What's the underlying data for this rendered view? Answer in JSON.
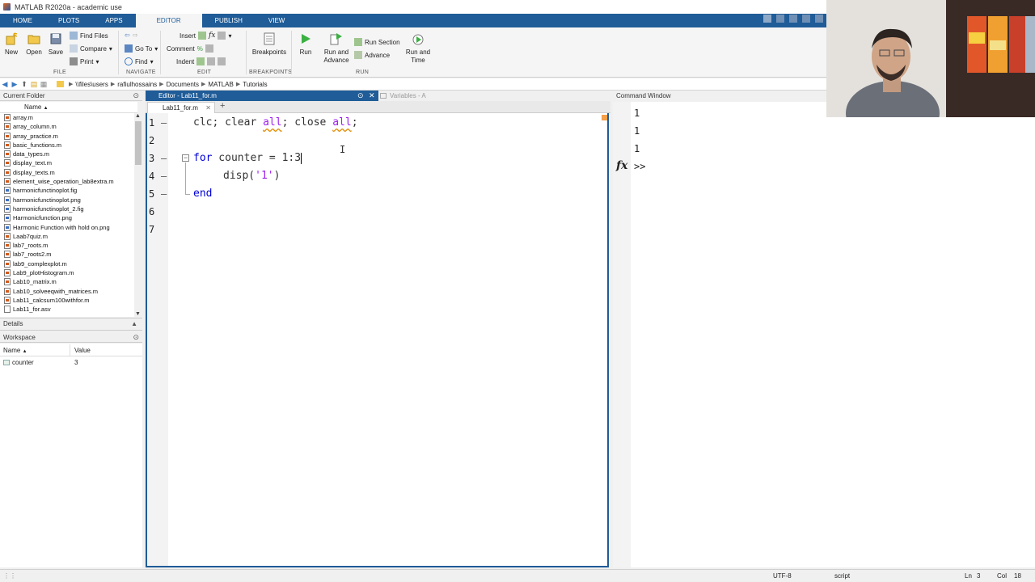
{
  "window": {
    "title": "MATLAB R2020a - academic use"
  },
  "main_tabs": [
    "HOME",
    "PLOTS",
    "APPS",
    "EDITOR",
    "PUBLISH",
    "VIEW"
  ],
  "active_tab": "EDITOR",
  "ribbon": {
    "file": {
      "new": "New",
      "open": "Open",
      "save": "Save",
      "find_files": "Find Files",
      "compare": "Compare",
      "print": "Print",
      "group": "FILE"
    },
    "navigate": {
      "go_to": "Go To",
      "find": "Find",
      "group": "NAVIGATE"
    },
    "edit": {
      "insert": "Insert",
      "comment": "Comment",
      "indent": "Indent",
      "fx": "fx",
      "group": "EDIT"
    },
    "breakpoints": {
      "label": "Breakpoints",
      "group": "BREAKPOINTS"
    },
    "run": {
      "run": "Run",
      "run_and_advance": "Run and Advance",
      "run_section": "Run Section",
      "advance": "Advance",
      "run_and_time": "Run and Time",
      "group": "RUN"
    }
  },
  "address": {
    "crumbs": [
      "\\\\files\\users",
      "rafiulhossains",
      "Documents",
      "MATLAB",
      "Tutorials"
    ]
  },
  "current_folder": {
    "title": "Current Folder",
    "column": "Name",
    "sort_indicator": "▲",
    "files": [
      {
        "name": "array.m",
        "type": "m"
      },
      {
        "name": "array_column.m",
        "type": "m"
      },
      {
        "name": "array_practice.m",
        "type": "m"
      },
      {
        "name": "basic_functions.m",
        "type": "m"
      },
      {
        "name": "data_types.m",
        "type": "m"
      },
      {
        "name": "display_text.m",
        "type": "m"
      },
      {
        "name": "display_texts.m",
        "type": "m"
      },
      {
        "name": "element_wise_operation_lab8extra.m",
        "type": "m"
      },
      {
        "name": "harmonicfunctinoplot.fig",
        "type": "f"
      },
      {
        "name": "harmonicfunctinoplot.png",
        "type": "f"
      },
      {
        "name": "harmonicfunctinoplot_2.fig",
        "type": "f"
      },
      {
        "name": "Harmonicfunction.png",
        "type": "f"
      },
      {
        "name": "Harmonic Function with hold on.png",
        "type": "f"
      },
      {
        "name": "Laab7quiz.m",
        "type": "m"
      },
      {
        "name": "lab7_roots.m",
        "type": "m"
      },
      {
        "name": "lab7_roots2.m",
        "type": "m"
      },
      {
        "name": "lab9_complexplot.m",
        "type": "m"
      },
      {
        "name": "Lab9_plotHistogram.m",
        "type": "m"
      },
      {
        "name": "Lab10_matrix.m",
        "type": "m"
      },
      {
        "name": "Lab10_solveeqwith_matrices.m",
        "type": "m"
      },
      {
        "name": "Lab11_calcsum100withfor.m",
        "type": "m"
      },
      {
        "name": "Lab11_for.asv",
        "type": "a"
      }
    ]
  },
  "details": {
    "title": "Details"
  },
  "workspace": {
    "title": "Workspace",
    "col_name": "Name",
    "col_value": "Value",
    "sort_indicator": "▲",
    "vars": [
      {
        "name": "counter",
        "value": "3"
      }
    ]
  },
  "editor": {
    "header": "Editor - Lab11_for.m",
    "variables_tab": "Variables - A",
    "file_tab": "Lab11_for.m",
    "add_tab": "+",
    "line_numbers": [
      "1",
      "2",
      "3",
      "4",
      "5",
      "6",
      "7"
    ],
    "code": {
      "l1_a": "clc; clear ",
      "l1_b": "all",
      "l1_c": "; close ",
      "l1_d": "all",
      "l1_e": ";",
      "l3_kw": "for",
      "l3_rest": " counter = 1:3",
      "l4_a": "disp(",
      "l4_b": "'1'",
      "l4_c": ")",
      "l5_kw": "end"
    }
  },
  "command_window": {
    "title": "Command Window",
    "output": [
      "1",
      "1",
      "1"
    ],
    "fx": "fx",
    "prompt": ">>"
  },
  "status": {
    "encoding": "UTF-8",
    "mode": "script",
    "ln_label": "Ln",
    "ln": "3",
    "col_label": "Col",
    "col": "18"
  },
  "colors": {
    "accent": "#1f5c98",
    "keyword": "#0000d8",
    "string": "#a020f0"
  }
}
